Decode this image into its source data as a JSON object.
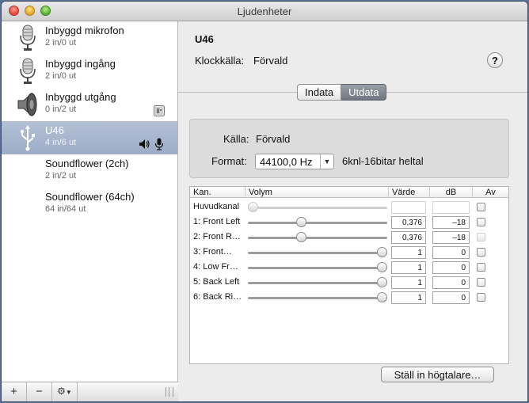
{
  "window": {
    "title": "Ljudenheter"
  },
  "sidebar": {
    "devices": [
      {
        "name": "Inbyggd mikrofon",
        "io": "2 in/0 ut",
        "icon": "microphone-icon"
      },
      {
        "name": "Inbyggd ingång",
        "io": "2 in/0 ut",
        "icon": "microphone-icon"
      },
      {
        "name": "Inbyggd utgång",
        "io": "0 in/2 ut",
        "icon": "speaker-icon"
      },
      {
        "name": "U46",
        "io": "4 in/6 ut",
        "icon": "usb-icon"
      },
      {
        "name": "Soundflower (2ch)",
        "io": "2 in/2 ut",
        "icon": ""
      },
      {
        "name": "Soundflower (64ch)",
        "io": "64 in/64 ut",
        "icon": ""
      }
    ],
    "footer": {
      "add": "+",
      "remove": "−"
    }
  },
  "detail": {
    "device_name": "U46",
    "clock_label": "Klockkälla:",
    "clock_value": "Förvald",
    "help": "?",
    "tabs": [
      {
        "label": "Indata",
        "active": false
      },
      {
        "label": "Utdata",
        "active": true
      }
    ],
    "source_label": "Källa:",
    "source_value": "Förvald",
    "format_label": "Format:",
    "format_value": "44100,0 Hz",
    "format_desc": "6knl-16bitar heltal",
    "table": {
      "headers": [
        "Kan.",
        "Volym",
        "Värde",
        "dB",
        "Av"
      ],
      "rows": [
        {
          "channel": "Huvudkanal",
          "level": 0.0,
          "value": "",
          "db": "",
          "enabled": false
        },
        {
          "channel": "1: Front Left",
          "level": 0.376,
          "value": "0,376",
          "db": "–18",
          "enabled": true
        },
        {
          "channel": "2: Front R…",
          "level": 0.376,
          "value": "0,376",
          "db": "–18",
          "enabled": true
        },
        {
          "channel": "3: Front…",
          "level": 1.0,
          "value": "1",
          "db": "0",
          "enabled": true
        },
        {
          "channel": "4: Low Fr…",
          "level": 1.0,
          "value": "1",
          "db": "0",
          "enabled": true
        },
        {
          "channel": "5: Back Left",
          "level": 1.0,
          "value": "1",
          "db": "0",
          "enabled": true
        },
        {
          "channel": "6: Back Ri…",
          "level": 1.0,
          "value": "1",
          "db": "0",
          "enabled": true
        }
      ]
    },
    "speaker_button": "Ställ in högtalare…"
  }
}
